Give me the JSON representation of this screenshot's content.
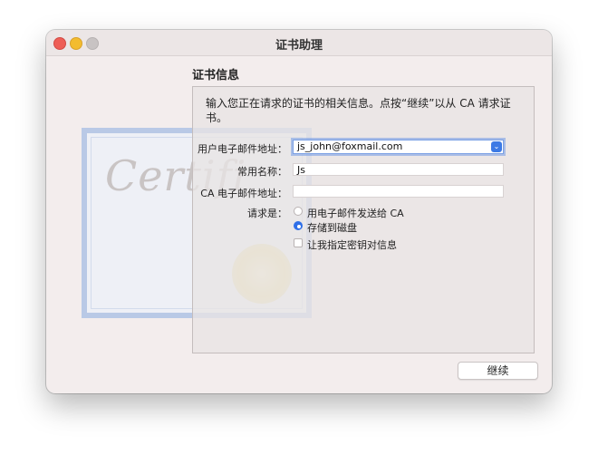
{
  "window": {
    "title": "证书助理"
  },
  "section": {
    "title": "证书信息",
    "intro": "输入您正在请求的证书的相关信息。点按“继续”以从 CA 请求证书。"
  },
  "certificate": {
    "script_text": "Certifi"
  },
  "form": {
    "email_label": "用户电子邮件地址：",
    "email_value": "js_john@foxmail.com",
    "common_name_label": "常用名称：",
    "common_name_value": "Js",
    "ca_email_label": "CA 电子邮件地址：",
    "ca_email_value": "",
    "request_label": "请求是：",
    "options": [
      {
        "label": "用电子邮件发送给 CA",
        "selected": false
      },
      {
        "label": "存储到磁盘",
        "selected": true
      }
    ],
    "key_pair_checkbox": {
      "label": "让我指定密钥对信息",
      "checked": false
    }
  },
  "footer": {
    "continue_label": "继续"
  },
  "colors": {
    "accent": "#2f6fe8",
    "close": "#ee5e56",
    "minimize": "#f3bc2f",
    "maximize": "#c8c3c3"
  },
  "icons": [
    "close-icon",
    "minimize-icon",
    "maximize-icon",
    "chevron-down-icon"
  ]
}
